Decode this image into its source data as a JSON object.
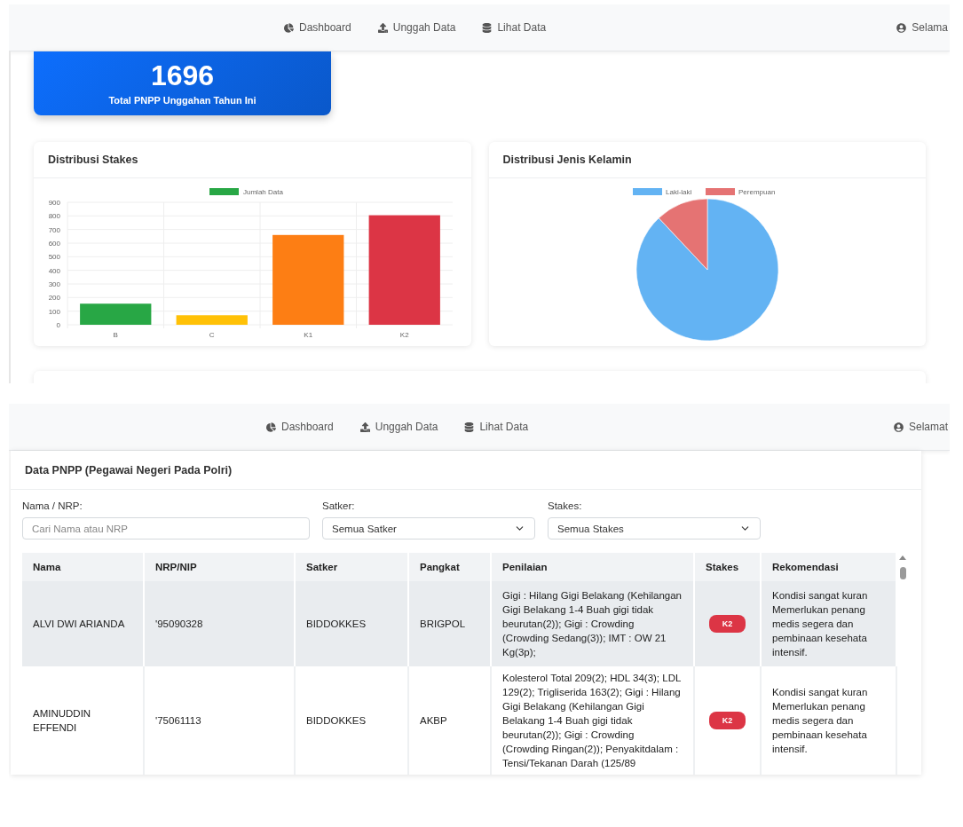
{
  "screens": [
    {
      "nav": {
        "items": [
          {
            "label": "Dashboard"
          },
          {
            "label": "Unggah Data"
          },
          {
            "label": "Lihat Data"
          }
        ],
        "user": "Selama"
      },
      "stat": {
        "value": "1696",
        "label": "Total PNPP Unggahan Tahun Ini"
      },
      "charts": [
        {
          "title": "Distribusi Stakes",
          "chart_data": {
            "type": "bar",
            "categories": [
              "B",
              "C",
              "K1",
              "K2"
            ],
            "series": [
              {
                "name": "Jumlah Data",
                "color": "#28a745",
                "colors": [
                  "#28a745",
                  "#ffc107",
                  "#fd7e14",
                  "#dc3545"
                ],
                "values": [
                  155,
                  70,
                  660,
                  805
                ]
              }
            ],
            "ylim": [
              0,
              900
            ],
            "yticks": [
              0,
              100,
              200,
              300,
              400,
              500,
              600,
              700,
              800,
              900
            ],
            "grid": true,
            "legend": "top"
          }
        },
        {
          "title": "Distribusi Jenis Kelamin",
          "chart_data": {
            "type": "pie",
            "categories": [
              "Laki-laki",
              "Perempuan"
            ],
            "series": [
              {
                "values": [
                  88,
                  12
                ],
                "colors": [
                  "#63b3f3",
                  "#e57373"
                ]
              }
            ],
            "legend": "top"
          }
        }
      ]
    },
    {
      "nav": {
        "items": [
          {
            "label": "Dashboard"
          },
          {
            "label": "Unggah Data"
          },
          {
            "label": "Lihat Data"
          }
        ],
        "user": "Selamat"
      },
      "data_card": {
        "title": "Data PNPP (Pegawai Negeri Pada Polri)",
        "filters": [
          {
            "kind": "input",
            "label": "Nama / NRP:",
            "placeholder": "Cari Nama atau NRP"
          },
          {
            "kind": "select",
            "label": "Satker:",
            "value": "Semua Satker"
          },
          {
            "kind": "select",
            "label": "Stakes:",
            "value": "Semua Stakes"
          }
        ],
        "table": {
          "columns": [
            "Nama",
            "NRP/NIP",
            "Satker",
            "Pangkat",
            "Penilaian",
            "Stakes",
            "Rekomendasi"
          ],
          "rows": [
            {
              "highlighted": true,
              "nama": "ALVI DWI ARIANDA",
              "nrp": "'95090328",
              "satker": "BIDDOKKES",
              "pangkat": "BRIGPOL",
              "penilaian": "Gigi : Hilang Gigi Belakang (Kehilangan Gigi Belakang 1-4 Buah gigi tidak beurutan(2)); Gigi : Crowding (Crowding Sedang(3)); IMT : OW 21 Kg(3p);",
              "stakes": {
                "label": "K2",
                "color": "#dc3545"
              },
              "rekomendasi": "Kondisi sangat kuran\nMemerlukan penang\nmedis segera dan\npembinaan kesehata\nintensif."
            },
            {
              "highlighted": false,
              "nama": "AMINUDDIN EFFENDI",
              "nrp": "'75061113",
              "satker": "BIDDOKKES",
              "pangkat": "AKBP",
              "penilaian": "Kolesterol Total 209(2); HDL 34(3); LDL 129(2); Trigliserida 163(2); Gigi : Hilang Gigi Belakang (Kehilangan Gigi Belakang 1-4 Buah gigi tidak beurutan(2)); Gigi : Crowding (Crowding Ringan(2)); Penyakitdalam : Tensi/Tekanan Darah (125/89",
              "stakes": {
                "label": "K2",
                "color": "#dc3545"
              },
              "rekomendasi": "Kondisi sangat kuran\nMemerlukan penang\nmedis segera dan\npembinaan kesehata\nintensif."
            }
          ]
        }
      }
    }
  ]
}
